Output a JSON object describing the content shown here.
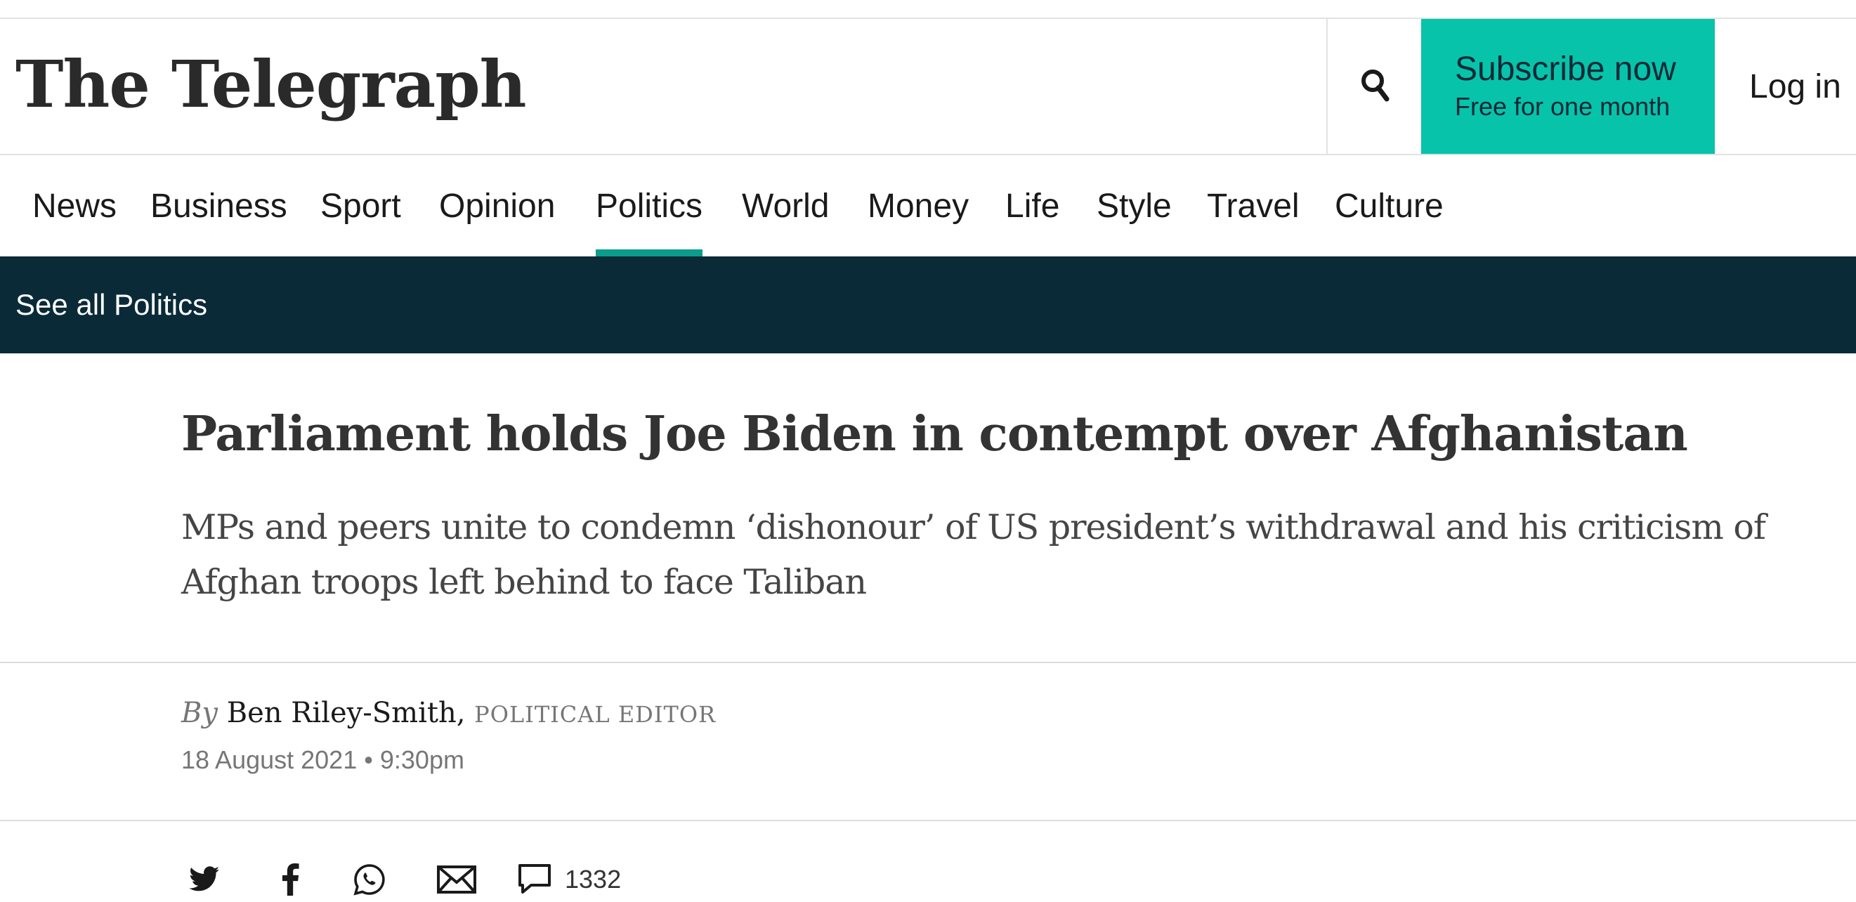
{
  "brand": {
    "logo_text": "The Telegraph"
  },
  "header": {
    "subscribe_title": "Subscribe now",
    "subscribe_subtitle": "Free for one month",
    "login_label": "Log in",
    "search_icon": "search-icon"
  },
  "nav": {
    "items": [
      {
        "label": "News"
      },
      {
        "label": "Business"
      },
      {
        "label": "Sport"
      },
      {
        "label": "Opinion"
      },
      {
        "label": "Politics"
      },
      {
        "label": "World"
      },
      {
        "label": "Money"
      },
      {
        "label": "Life"
      },
      {
        "label": "Style"
      },
      {
        "label": "Travel"
      },
      {
        "label": "Culture"
      }
    ],
    "active": "Politics"
  },
  "subnav": {
    "link_label": "See all Politics"
  },
  "article": {
    "headline": "Parliament holds Joe Biden in contempt over Afghanistan",
    "standfirst": "MPs and peers unite to condemn ‘dishonour’ of US president’s withdrawal and his criticism of Afghan troops left behind to face Taliban",
    "by_word": "By",
    "author": "Ben Riley-Smith,",
    "role": "POLITICAL EDITOR",
    "date": "18 August 2021",
    "separator": "•",
    "time": "9:30pm"
  },
  "share": {
    "icons": [
      "twitter-icon",
      "facebook-icon",
      "whatsapp-icon",
      "email-icon",
      "comment-icon"
    ],
    "comment_count": "1332"
  },
  "colors": {
    "accent": "#07c3a9",
    "nav_underline": "#0b9c8b",
    "subnav_bg": "#0a2a38",
    "headline": "#333333",
    "muted": "#767676"
  }
}
